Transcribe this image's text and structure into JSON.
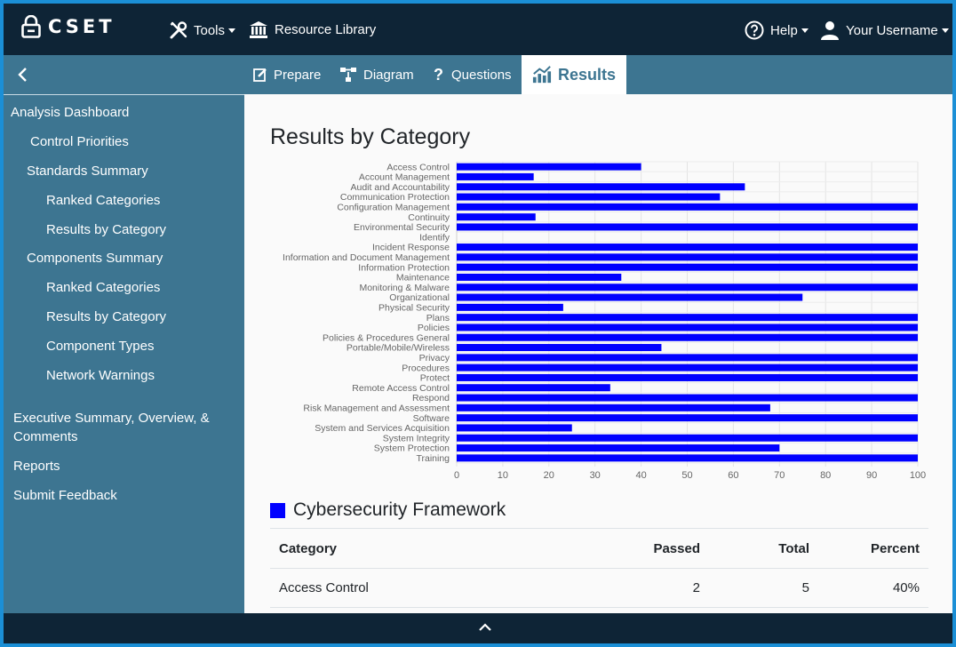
{
  "app": {
    "name": "CSET"
  },
  "topbar": {
    "tools_label": "Tools",
    "library_label": "Resource Library",
    "help_label": "Help",
    "user_label": "Your Username"
  },
  "tabs": [
    {
      "label": "Prepare",
      "icon": "edit-icon"
    },
    {
      "label": "Diagram",
      "icon": "diagram-icon"
    },
    {
      "label": "Questions",
      "icon": "question-icon"
    },
    {
      "label": "Results",
      "icon": "results-chart-icon",
      "active": true
    }
  ],
  "sidebar": {
    "items": [
      {
        "label": "Analysis Dashboard"
      },
      {
        "label": "Control Priorities"
      },
      {
        "label": "Standards Summary"
      },
      {
        "label": "Ranked Categories"
      },
      {
        "label": "Results by Category"
      },
      {
        "label": "Components Summary"
      },
      {
        "label": "Ranked Categories"
      },
      {
        "label": "Results by Category"
      },
      {
        "label": "Component Types"
      },
      {
        "label": "Network Warnings"
      },
      {
        "label": "Executive Summary, Overview, & Comments"
      },
      {
        "label": "Reports"
      },
      {
        "label": "Submit Feedback"
      }
    ]
  },
  "main": {
    "title": "Results by Category",
    "legend_label": "Cybersecurity Framework",
    "legend_color": "#0000ff",
    "table": {
      "headers": [
        "Category",
        "Passed",
        "Total",
        "Percent"
      ],
      "rows": [
        [
          "Access Control",
          "2",
          "5",
          "40%"
        ]
      ]
    }
  },
  "chart_data": {
    "type": "bar",
    "orientation": "horizontal",
    "categories": [
      "Access Control",
      "Account Management",
      "Audit and Accountability",
      "Communication Protection",
      "Configuration Management",
      "Continuity",
      "Environmental Security",
      "Identify",
      "Incident Response",
      "Information and Document Management",
      "Information Protection",
      "Maintenance",
      "Monitoring & Malware",
      "Organizational",
      "Physical Security",
      "Plans",
      "Policies",
      "Policies & Procedures General",
      "Portable/Mobile/Wireless",
      "Privacy",
      "Procedures",
      "Protect",
      "Remote Access Control",
      "Respond",
      "Risk Management and Assessment",
      "Software",
      "System and Services Acquisition",
      "System Integrity",
      "System Protection",
      "Training"
    ],
    "series": [
      {
        "name": "Cybersecurity Framework",
        "values": [
          40,
          16.7,
          62.5,
          57.1,
          100,
          17.1,
          100,
          0,
          100,
          100,
          100,
          35.7,
          100,
          75,
          23.1,
          100,
          100,
          100,
          44.4,
          100,
          100,
          100,
          33.3,
          100,
          68,
          100,
          25,
          100,
          70,
          100
        ]
      }
    ],
    "xlim": [
      0,
      100
    ],
    "xticks": [
      0,
      10,
      20,
      30,
      40,
      50,
      60,
      70,
      80,
      90,
      100
    ],
    "bar_color": "#0000ff",
    "grid": true
  }
}
